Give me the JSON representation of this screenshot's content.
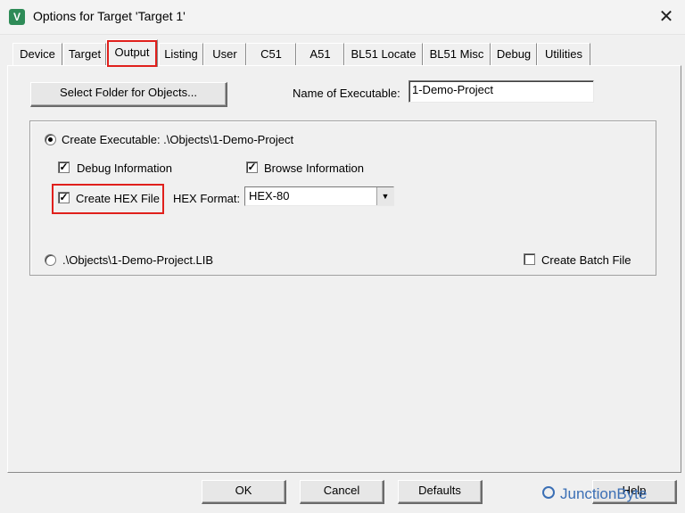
{
  "window": {
    "title": "Options for Target 'Target 1'",
    "app_icon": "V",
    "close_glyph": "✕"
  },
  "tabs": [
    {
      "label": "Device"
    },
    {
      "label": "Target"
    },
    {
      "label": "Output"
    },
    {
      "label": "Listing"
    },
    {
      "label": "User"
    },
    {
      "label": "C51"
    },
    {
      "label": "A51"
    },
    {
      "label": "BL51 Locate"
    },
    {
      "label": "BL51 Misc"
    },
    {
      "label": "Debug"
    },
    {
      "label": "Utilities"
    }
  ],
  "active_tab": "Output",
  "output": {
    "select_folder_button": "Select Folder for Objects...",
    "name_label": "Name of Executable:",
    "name_value": "1-Demo-Project",
    "create_executable_label": "Create Executable:  .\\Objects\\1-Demo-Project",
    "debug_info_label": "Debug Information",
    "browse_info_label": "Browse Information",
    "create_hex_label": "Create HEX File",
    "hex_format_label": "HEX Format:",
    "hex_format_value": "HEX-80",
    "create_lib_label": ".\\Objects\\1-Demo-Project.LIB",
    "batch_file_label": "Create Batch File"
  },
  "buttons": {
    "ok": "OK",
    "cancel": "Cancel",
    "defaults": "Defaults",
    "help": "Help"
  },
  "watermark": "JunctionByte",
  "colors": {
    "highlight": "#e0201c",
    "watermark": "#3b6fb5",
    "app_icon_bg": "#2e8b57"
  }
}
